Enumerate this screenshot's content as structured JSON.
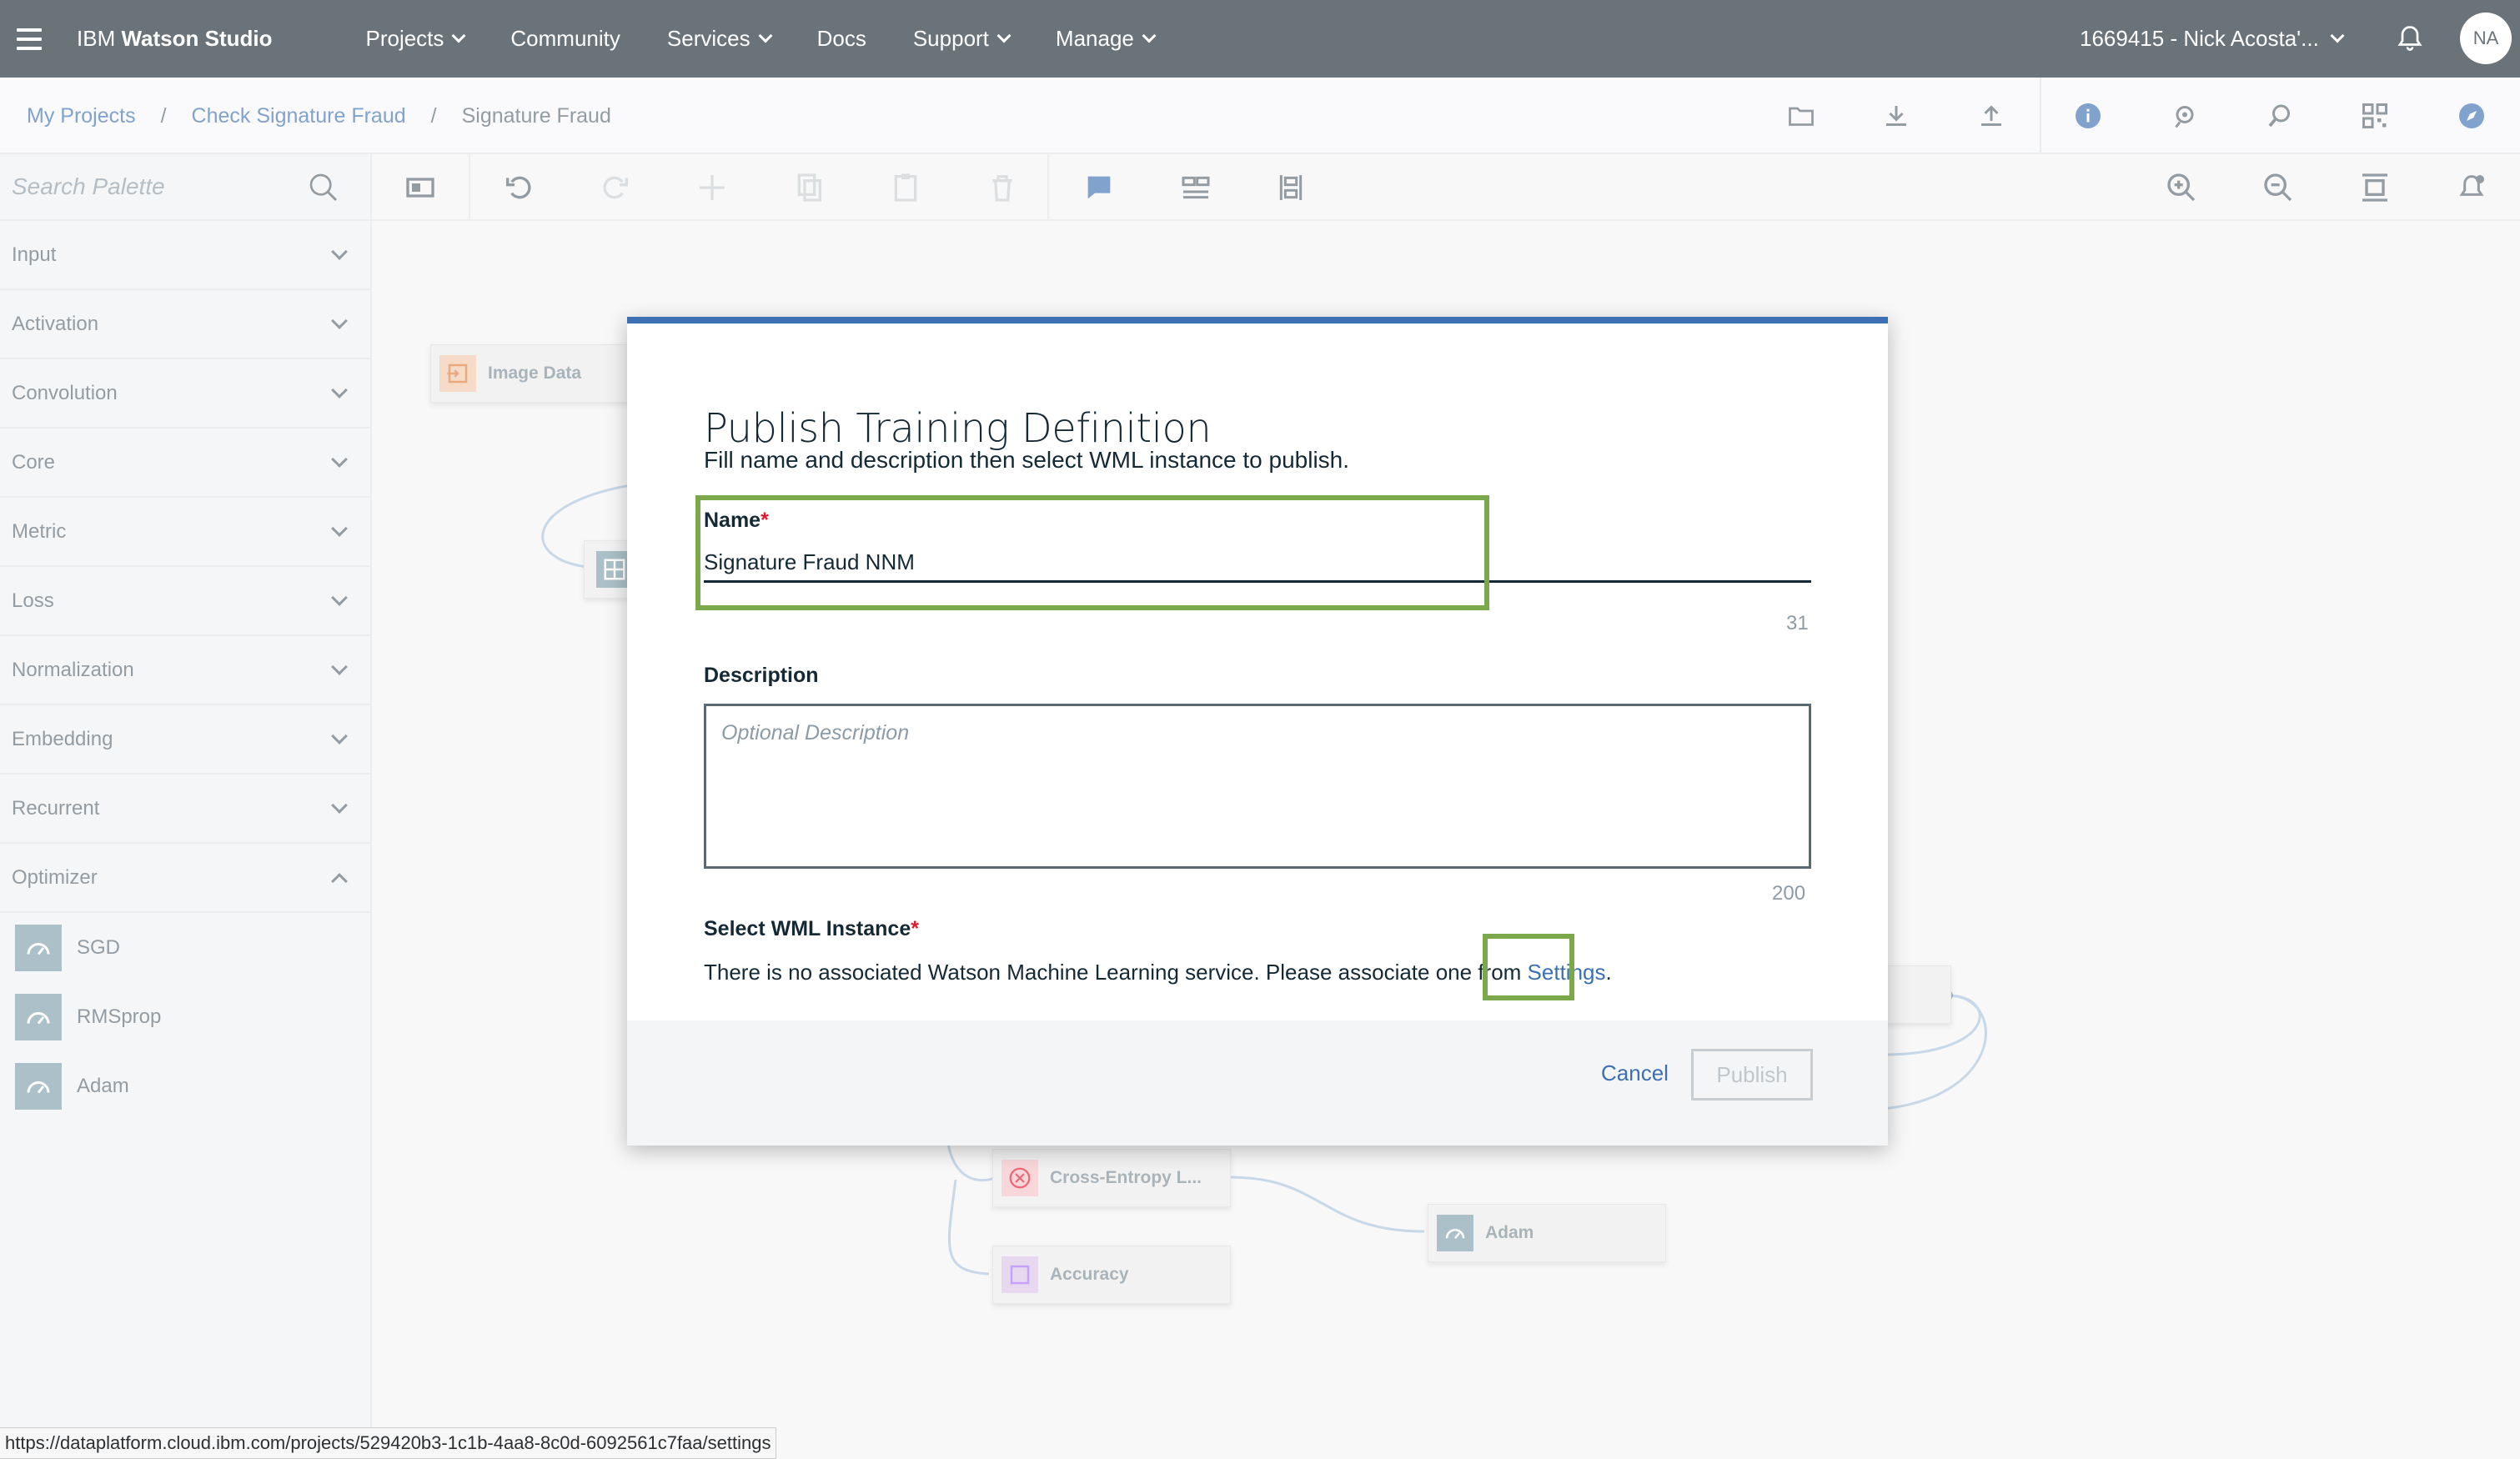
{
  "app": {
    "brand_prefix": "IBM",
    "brand_name": "Watson Studio"
  },
  "nav": [
    {
      "label": "Projects",
      "has_dropdown": true
    },
    {
      "label": "Community",
      "has_dropdown": false
    },
    {
      "label": "Services",
      "has_dropdown": true
    },
    {
      "label": "Docs",
      "has_dropdown": false
    },
    {
      "label": "Support",
      "has_dropdown": true
    },
    {
      "label": "Manage",
      "has_dropdown": true
    }
  ],
  "account": {
    "label": "1669415 - Nick Acosta'...",
    "avatar_initials": "NA"
  },
  "breadcrumb": {
    "items": [
      "My Projects",
      "Check Signature Fraud"
    ],
    "separator": "/",
    "current": "Signature Fraud"
  },
  "palette": {
    "search_placeholder": "Search Palette",
    "categories": [
      {
        "label": "Input",
        "expanded": false
      },
      {
        "label": "Activation",
        "expanded": false
      },
      {
        "label": "Convolution",
        "expanded": false
      },
      {
        "label": "Core",
        "expanded": false
      },
      {
        "label": "Metric",
        "expanded": false
      },
      {
        "label": "Loss",
        "expanded": false
      },
      {
        "label": "Normalization",
        "expanded": false
      },
      {
        "label": "Embedding",
        "expanded": false
      },
      {
        "label": "Recurrent",
        "expanded": false
      },
      {
        "label": "Optimizer",
        "expanded": true
      }
    ],
    "optimizer_items": [
      "SGD",
      "RMSprop",
      "Adam"
    ]
  },
  "canvas": {
    "nodes": {
      "image_data": "Image Data",
      "cross_entropy": "Cross-Entropy L...",
      "accuracy": "Accuracy",
      "adam": "Adam"
    }
  },
  "modal": {
    "title": "Publish Training Definition",
    "subtitle": "Fill name and description then select WML instance to publish.",
    "name_label": "Name",
    "name_value": "Signature Fraud NNM",
    "name_counter": "31",
    "description_label": "Description",
    "description_placeholder": "Optional Description",
    "description_counter": "200",
    "wml_label": "Select WML Instance",
    "required_mark": "*",
    "wml_text": "There is no associated Watson Machine Learning service. Please associate one from ",
    "settings_link": "Settings",
    "wml_text_end": ".",
    "cancel_label": "Cancel",
    "publish_label": "Publish"
  },
  "status_bar": {
    "url": "https://dataplatform.cloud.ibm.com/projects/529420b3-1c1b-4aa8-8c0d-6092561c7faa/settings"
  },
  "colors": {
    "topbar": "#1b2834",
    "accent": "#3d70b2",
    "highlight": "#7ba84b",
    "required": "#e0182d"
  }
}
